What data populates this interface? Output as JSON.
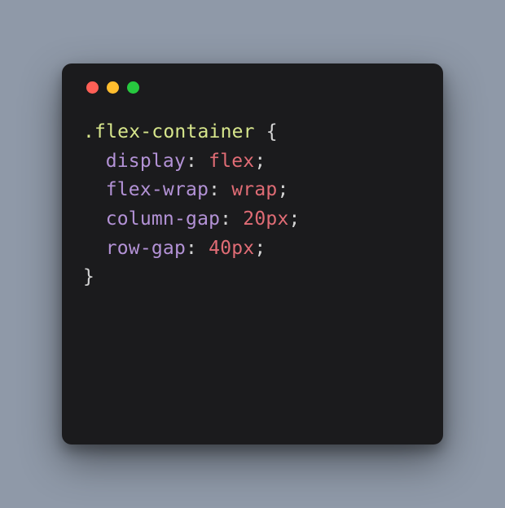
{
  "code": {
    "selector": ".flex-container",
    "open_brace": "{",
    "close_brace": "}",
    "lines": [
      {
        "property": "display",
        "value": "flex"
      },
      {
        "property": "flex-wrap",
        "value": "wrap"
      },
      {
        "property": "column-gap",
        "value": "20px"
      },
      {
        "property": "row-gap",
        "value": "40px"
      }
    ],
    "colon": ":",
    "semicolon": ";"
  }
}
